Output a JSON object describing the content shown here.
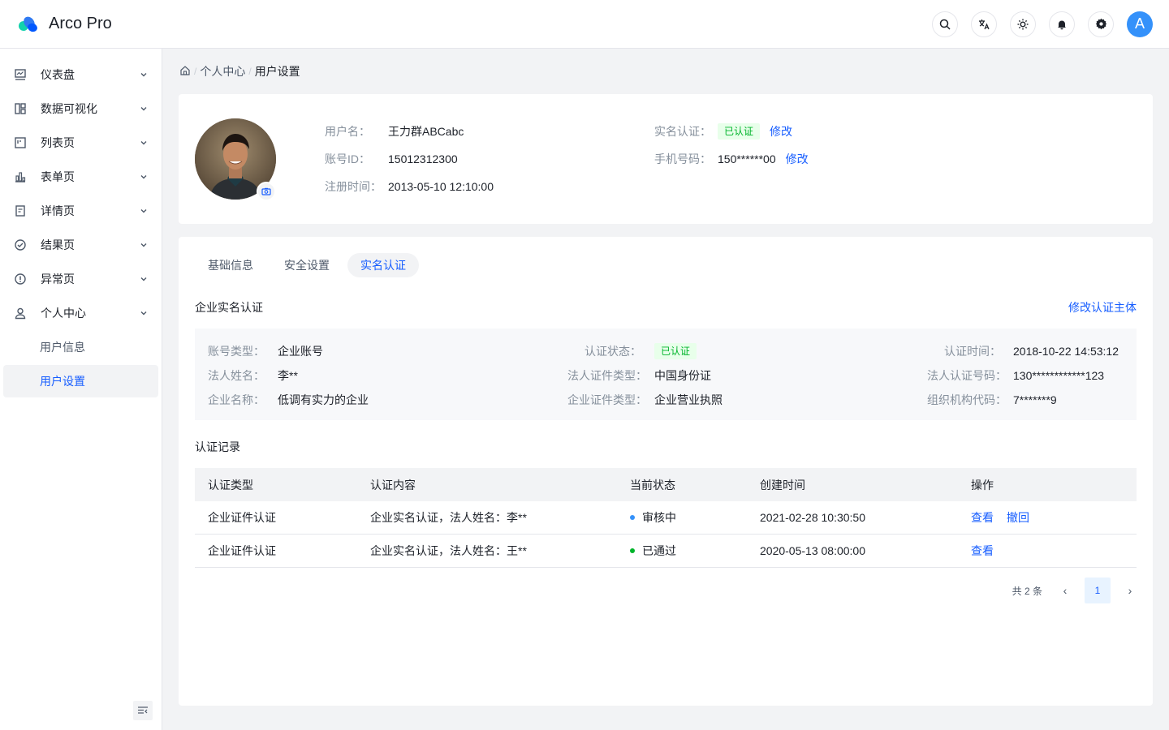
{
  "app": {
    "title": "Arco Pro"
  },
  "header": {
    "avatar_letter": "A"
  },
  "sidebar": {
    "items": [
      {
        "label": "仪表盘"
      },
      {
        "label": "数据可视化"
      },
      {
        "label": "列表页"
      },
      {
        "label": "表单页"
      },
      {
        "label": "详情页"
      },
      {
        "label": "结果页"
      },
      {
        "label": "异常页"
      },
      {
        "label": "个人中心"
      }
    ],
    "sub_items": [
      {
        "label": "用户信息"
      },
      {
        "label": "用户设置"
      }
    ]
  },
  "breadcrumb": {
    "level1": "个人中心",
    "current": "用户设置",
    "separator": "/"
  },
  "profile": {
    "username_label": "用户名：",
    "username": "王力群ABCabc",
    "account_label": "账号ID：",
    "account_id": "15012312300",
    "register_label": "注册时间：",
    "register_time": "2013-05-10 12:10:00",
    "realname_label": "实名认证：",
    "realname_status": "已认证",
    "realname_edit": "修改",
    "phone_label": "手机号码：",
    "phone": "150******00",
    "phone_edit": "修改"
  },
  "tabs": [
    {
      "label": "基础信息"
    },
    {
      "label": "安全设置"
    },
    {
      "label": "实名认证"
    }
  ],
  "enterprise": {
    "title": "企业实名认证",
    "edit_link": "修改认证主体",
    "fields": {
      "account_type_label": "账号类型：",
      "account_type": "企业账号",
      "legal_name_label": "法人姓名：",
      "legal_name": "李**",
      "company_label": "企业名称：",
      "company": "低调有实力的企业",
      "status_label": "认证状态：",
      "status": "已认证",
      "legal_id_type_label": "法人证件类型：",
      "legal_id_type": "中国身份证",
      "company_id_type_label": "企业证件类型：",
      "company_id_type": "企业营业执照",
      "auth_time_label": "认证时间：",
      "auth_time": "2018-10-22 14:53:12",
      "legal_no_label": "法人认证号码：",
      "legal_no": "130************123",
      "org_code_label": "组织机构代码：",
      "org_code": "7*******9"
    }
  },
  "records": {
    "title": "认证记录",
    "columns": [
      "认证类型",
      "认证内容",
      "当前状态",
      "创建时间",
      "操作"
    ],
    "rows": [
      {
        "type": "企业证件认证",
        "content": "企业实名认证，法人姓名：李**",
        "status": "审核中",
        "status_color": "#3491fa",
        "created": "2021-02-28 10:30:50",
        "action1": "查看",
        "action2": "撤回"
      },
      {
        "type": "企业证件认证",
        "content": "企业实名认证，法人姓名：王**",
        "status": "已通过",
        "status_color": "#00b42a",
        "created": "2020-05-13 08:00:00",
        "action1": "查看",
        "action2": ""
      }
    ]
  },
  "pagination": {
    "total_text": "共 2 条",
    "current_page": "1",
    "prev": "‹",
    "next": "›"
  }
}
